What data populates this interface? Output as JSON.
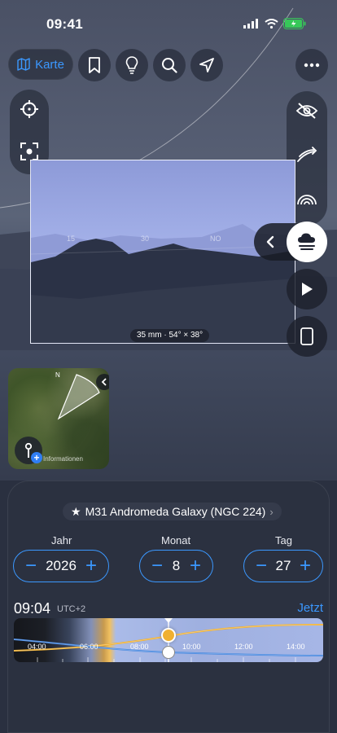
{
  "status": {
    "time": "09:41"
  },
  "toolbar": {
    "map_label": "Karte"
  },
  "camera": {
    "frame_label": "35 mm · 54° × 38°",
    "headings": [
      "15",
      "30",
      "NO"
    ]
  },
  "minimap": {
    "north_label": "N",
    "info_label": "Informationen",
    "plus": "+"
  },
  "object": {
    "star": "★",
    "name": "M31 Andromeda Galaxy (NGC 224)",
    "chevron": "›"
  },
  "date": {
    "year_label": "Jahr",
    "year_value": "2026",
    "month_label": "Monat",
    "month_value": "8",
    "day_label": "Tag",
    "day_value": "27",
    "minus": "−",
    "plus": "+"
  },
  "time": {
    "value": "09:04",
    "tz": "UTC+2",
    "now_label": "Jetzt",
    "ticks": [
      "04:00",
      "06:00",
      "08:00",
      "10:00",
      "12:00",
      "14:00"
    ]
  },
  "colors": {
    "accent": "#3b98ff",
    "sun": "#f0b030",
    "moon_line": "#4a8ae0"
  }
}
